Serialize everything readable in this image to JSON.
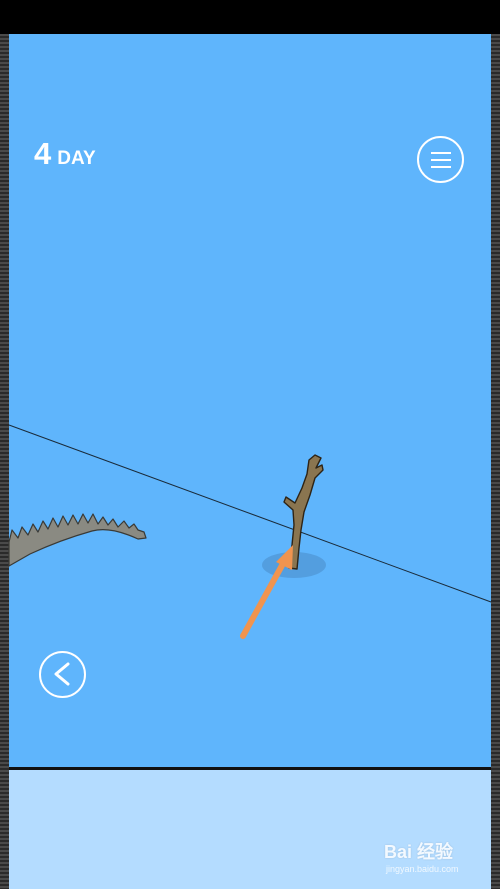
{
  "hud": {
    "day_number": "4",
    "day_label": "DAY"
  },
  "icons": {
    "menu": "hamburger-menu-icon",
    "back": "chevron-left-icon",
    "arrow": "orange-arrow-icon"
  },
  "colors": {
    "sky": "#5fb5fc",
    "bottom_panel": "#b4dcff",
    "arrow": "#f0944f",
    "branch": "#8a7550",
    "creature": "#8a8a82"
  },
  "watermark": {
    "brand": "Bai 经验",
    "url": "jingyan.baidu.com"
  }
}
